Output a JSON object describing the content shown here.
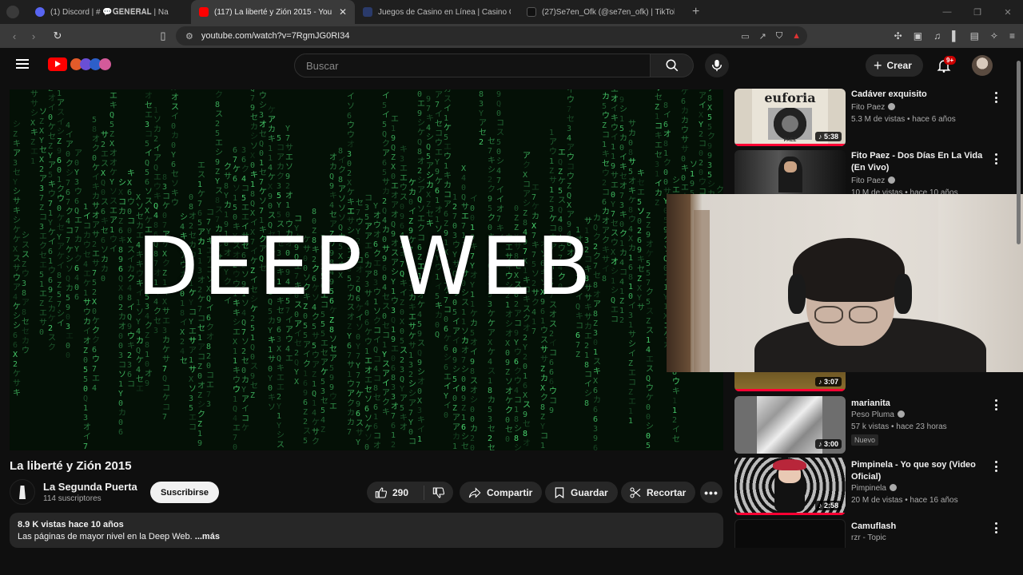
{
  "browser": {
    "tabs": [
      {
        "title": "(1) Discord | # 💬𝐆𝐄𝐍𝐄𝐑𝐀𝐋 | Na",
        "favicon_color": "#5865f2",
        "active": false
      },
      {
        "title": "(117) La liberté y Zión 2015 - You",
        "favicon_color": "#ff0000",
        "active": true
      },
      {
        "title": "Juegos de Casino en Línea | Casino O",
        "favicon_color": "#2a3a6a",
        "active": false
      },
      {
        "title": "(27)Se7en_Ofk (@se7en_ofk) | TikTok",
        "favicon_color": "#111111",
        "active": false
      }
    ],
    "close_glyph": "✕",
    "new_tab_glyph": "+",
    "url": "youtube.com/watch?v=7RgmJG0RI34"
  },
  "header": {
    "search_placeholder": "Buscar",
    "create_label": "Crear",
    "notifications_badge": "9+"
  },
  "video": {
    "overlay_text": "DEEP WEB",
    "title": "La liberté y Zión 2015",
    "channel": "La Segunda Puerta",
    "subscribers": "114 suscriptores",
    "subscribe_label": "Suscribirse",
    "likes": "290",
    "share_label": "Compartir",
    "save_label": "Guardar",
    "clip_label": "Recortar",
    "views_and_date": "8.9 K vistas  hace 10 años",
    "description": "Las páginas de mayor nivel en la Deep Web. ",
    "more_label": "...más"
  },
  "recommendations": [
    {
      "title": "Cadáver exquisito",
      "channel": "Fito Paez",
      "verified": true,
      "meta": "5.3 M de vistas • hace 6 años",
      "duration": "5:38",
      "thumb_text": "euforia",
      "thumb_sub": "PAEZ"
    },
    {
      "title": "Fito Paez - Dos Días En La Vida (En Vivo)",
      "channel": "Fito Paez",
      "verified": true,
      "meta": "10 M de vistas • hace 10 años",
      "duration": ""
    },
    {
      "title": "",
      "channel": "",
      "verified": false,
      "meta": "",
      "duration": "3:07"
    },
    {
      "title": "marianita",
      "channel": "Peso Pluma",
      "verified": true,
      "meta": "57 k vistas • hace 23 horas",
      "badge": "Nuevo",
      "duration": "3:00"
    },
    {
      "title": "Pimpinela - Yo que soy (Video Oficial)",
      "channel": "Pimpinela",
      "verified": true,
      "meta": "20 M de vistas • hace 16 años",
      "duration": "2:58"
    },
    {
      "title": "Camuflash",
      "channel": "rzr - Topic",
      "verified": false,
      "meta": "",
      "duration": ""
    }
  ]
}
